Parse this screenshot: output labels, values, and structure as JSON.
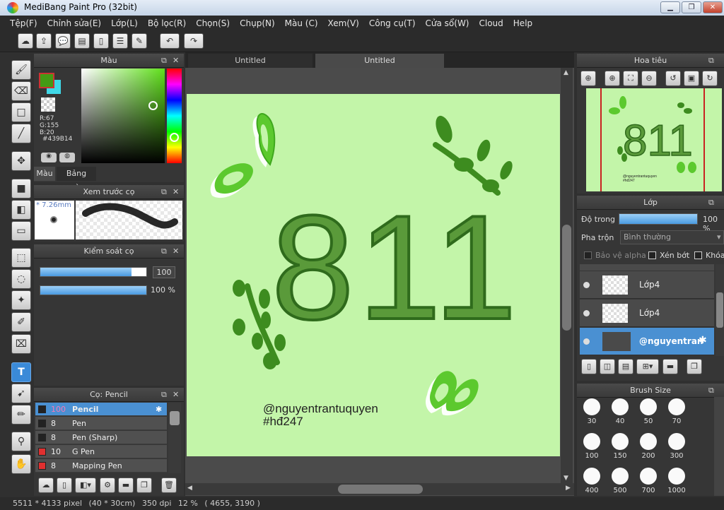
{
  "app": {
    "title": "MediBang Paint Pro (32bit)"
  },
  "menu": [
    "Tệp(F)",
    "Chỉnh sửa(E)",
    "Lớp(L)",
    "Bộ lọc(R)",
    "Chọn(S)",
    "Chụp(N)",
    "Màu (C)",
    "Xem(V)",
    "Công cụ(T)",
    "Cửa sổ(W)",
    "Cloud",
    "Help"
  ],
  "color_panel": {
    "title": "Màu",
    "r": "R:67",
    "g": "G:155",
    "b": "B:20",
    "hex": "#439B14",
    "tab_color": "Màu",
    "tab_palette": "Bảng màu",
    "primary_color": "#439b14",
    "secondary_color": "#40d8e8"
  },
  "brush_preview": {
    "title": "Xem trước cọ",
    "size": "* 7.26mm"
  },
  "brush_control": {
    "title": "Kiểm soát cọ",
    "size_value": "100",
    "opacity_value": "100 %",
    "size_fraction": 0.86,
    "opacity_fraction": 1.0
  },
  "brush_list": {
    "title": "Cọ: Pencil",
    "items": [
      {
        "size": "100",
        "name": "Pencil",
        "color": "#222222",
        "selected": true
      },
      {
        "size": "8",
        "name": "Pen",
        "color": "#222222"
      },
      {
        "size": "8",
        "name": "Pen (Sharp)",
        "color": "#222222"
      },
      {
        "size": "10",
        "name": "G Pen",
        "color": "#e03030"
      },
      {
        "size": "8",
        "name": "Mapping Pen",
        "color": "#e03030"
      }
    ]
  },
  "tabs": [
    "Untitled",
    "Untitled"
  ],
  "canvas_text": {
    "big": "811",
    "line1": "@nguyentrantuquyen",
    "line2": "#hđ247"
  },
  "navigator": {
    "title": "Hoa tiêu"
  },
  "layer_panel": {
    "title": "Lớp",
    "opacity_label": "Độ trong",
    "opacity_value": "100 %",
    "blend_label": "Pha trộn",
    "blend_value": "Bình thường",
    "protect_alpha": "Bảo vệ alpha",
    "clip": "Xén bớt",
    "lock": "Khóa",
    "layers": [
      {
        "name": "Lớp4",
        "selected": false
      },
      {
        "name": "Lớp4",
        "selected": false
      },
      {
        "name": "@nguyentran",
        "selected": true
      }
    ]
  },
  "brush_size": {
    "title": "Brush Size",
    "sizes": [
      "30",
      "40",
      "50",
      "70",
      "100",
      "150",
      "200",
      "300",
      "400",
      "500",
      "700",
      "1000"
    ]
  },
  "status": {
    "pixels": "5511 * 4133 pixel",
    "cm": "(40 * 30cm)",
    "dpi": "350 dpi",
    "zoom": "12 %",
    "coords": "( 4655, 3190 )"
  }
}
